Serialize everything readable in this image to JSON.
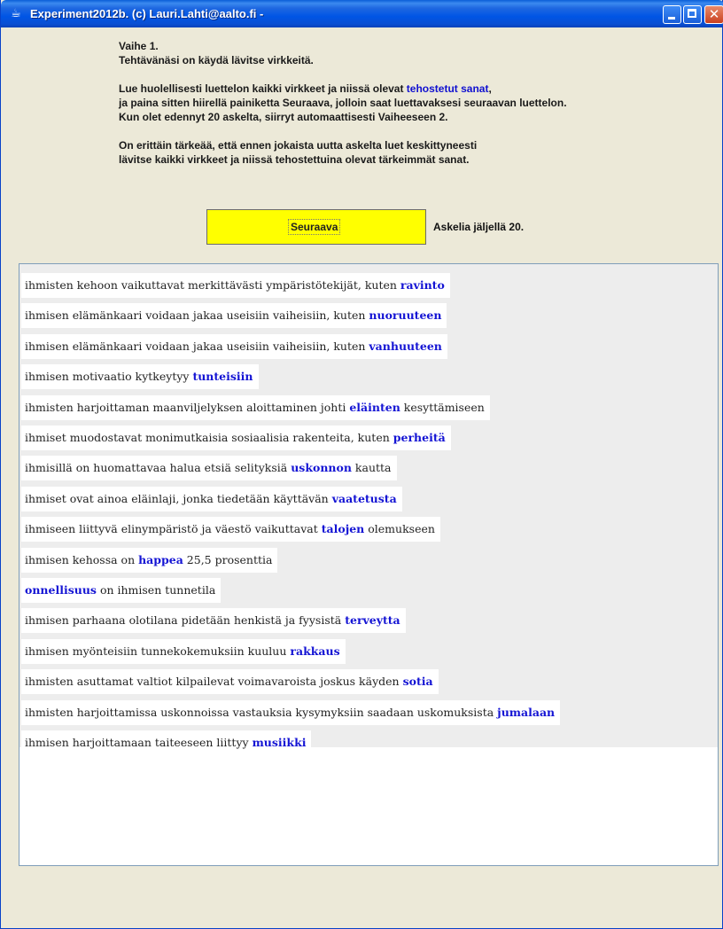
{
  "window": {
    "title": "Experiment2012b. (c) Lauri.Lahti@aalto.fi -",
    "icons": {
      "app": "java-cup-icon",
      "minimize": "minimize-icon",
      "maximize": "maximize-icon",
      "close": "close-icon"
    }
  },
  "instructions": {
    "phase": "Vaihe 1.",
    "task": "Tehtävänäsi on käydä lävitse virkkeitä.",
    "p2_before": "Lue huolellisesti luettelon kaikki virkkeet ja niissä olevat ",
    "p2_highlight": "tehostetut sanat",
    "p2_after": ",",
    "p2_line2": "ja paina sitten hiirellä painiketta Seuraava, jolloin saat luettavaksesi seuraavan luettelon.",
    "p2_line3": "Kun olet edennyt 20 askelta, siirryt automaattisesti Vaiheeseen 2.",
    "p3_line1": "On erittäin tärkeää, että ennen jokaista uutta askelta luet keskittyneesti",
    "p3_line2": "lävitse kaikki virkkeet ja niissä tehostettuina olevat tärkeimmät sanat."
  },
  "controls": {
    "next_label": "Seuraava",
    "steps_left_text": "Askelia jäljellä 20."
  },
  "sentences": [
    {
      "before": "ihmisten kehoon vaikuttavat merkittävästi ympäristötekijät, kuten ",
      "keyword": "ravinto",
      "after": ""
    },
    {
      "before": "ihmisen elämänkaari voidaan jakaa useisiin vaiheisiin, kuten ",
      "keyword": "nuoruuteen",
      "after": ""
    },
    {
      "before": "ihmisen elämänkaari voidaan jakaa useisiin vaiheisiin, kuten ",
      "keyword": "vanhuuteen",
      "after": ""
    },
    {
      "before": "ihmisen motivaatio kytkeytyy ",
      "keyword": "tunteisiin",
      "after": ""
    },
    {
      "before": "ihmisten harjoittaman maanviljelyksen aloittaminen johti ",
      "keyword": "eläinten",
      "after": " kesyttämiseen"
    },
    {
      "before": "ihmiset muodostavat monimutkaisia sosiaalisia rakenteita, kuten ",
      "keyword": "perheitä",
      "after": ""
    },
    {
      "before": "ihmisillä on huomattavaa halua etsiä selityksiä ",
      "keyword": "uskonnon",
      "after": " kautta"
    },
    {
      "before": "ihmiset ovat ainoa eläinlaji, jonka tiedetään käyttävän ",
      "keyword": "vaatetusta",
      "after": ""
    },
    {
      "before": "ihmiseen liittyvä elinympäristö ja väestö vaikuttavat ",
      "keyword": "talojen",
      "after": " olemukseen"
    },
    {
      "before": "ihmisen kehossa on ",
      "keyword": "happea",
      "after": " 25,5 prosenttia"
    },
    {
      "before": "",
      "keyword": "onnellisuus",
      "after": " on ihmisen tunnetila"
    },
    {
      "before": "ihmisen parhaana olotilana pidetään henkistä ja fyysistä ",
      "keyword": "terveytta",
      "after": ""
    },
    {
      "before": "ihmisen myönteisiin tunnekokemuksiin kuuluu ",
      "keyword": "rakkaus",
      "after": ""
    },
    {
      "before": "ihmisten asuttamat valtiot kilpailevat voimavaroista joskus käyden ",
      "keyword": "sotia",
      "after": ""
    },
    {
      "before": "ihmisten harjoittamissa uskonnoissa vastauksia kysymyksiin saadaan uskomuksista ",
      "keyword": "jumalaan",
      "after": ""
    },
    {
      "before": "ihmisen harjoittamaan taiteeseen liittyy ",
      "keyword": "musiikki",
      "after": ""
    }
  ],
  "colors": {
    "titlebar": "#0055e5",
    "highlight": "#1414d4",
    "button": "#ffff00",
    "background": "#ece9d8"
  }
}
